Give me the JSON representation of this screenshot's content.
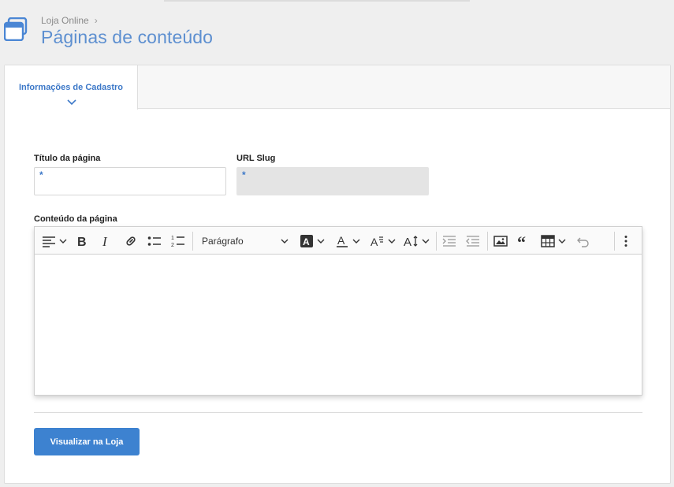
{
  "header": {
    "breadcrumb": "Loja Online",
    "title": "Páginas de conteúdo",
    "app_icon": "windows-icon"
  },
  "tabs": [
    {
      "label": "Informações de Cadastro",
      "active": true
    }
  ],
  "form": {
    "title_label": "Título da página",
    "title_required": "*",
    "title_value": "",
    "slug_label": "URL Slug",
    "slug_required": "*",
    "slug_value": "",
    "content_label": "Conteúdo da página"
  },
  "editor": {
    "paragraph_select": "Parágrafo",
    "toolbar_icons": [
      "align-left-icon",
      "bold-icon",
      "italic-icon",
      "link-icon",
      "bulleted-list-icon",
      "numbered-list-icon",
      "highlight-icon",
      "font-color-icon",
      "font-size-icon",
      "text-height-icon",
      "outdent-icon",
      "indent-icon",
      "image-icon",
      "blockquote-icon",
      "table-icon",
      "undo-icon",
      "more-options-icon"
    ],
    "content": ""
  },
  "actions": {
    "view_store_label": "Visualizar na Loja"
  },
  "colors": {
    "accent": "#3c78c8",
    "title": "#5d8fd0",
    "button": "#3d82d0"
  }
}
